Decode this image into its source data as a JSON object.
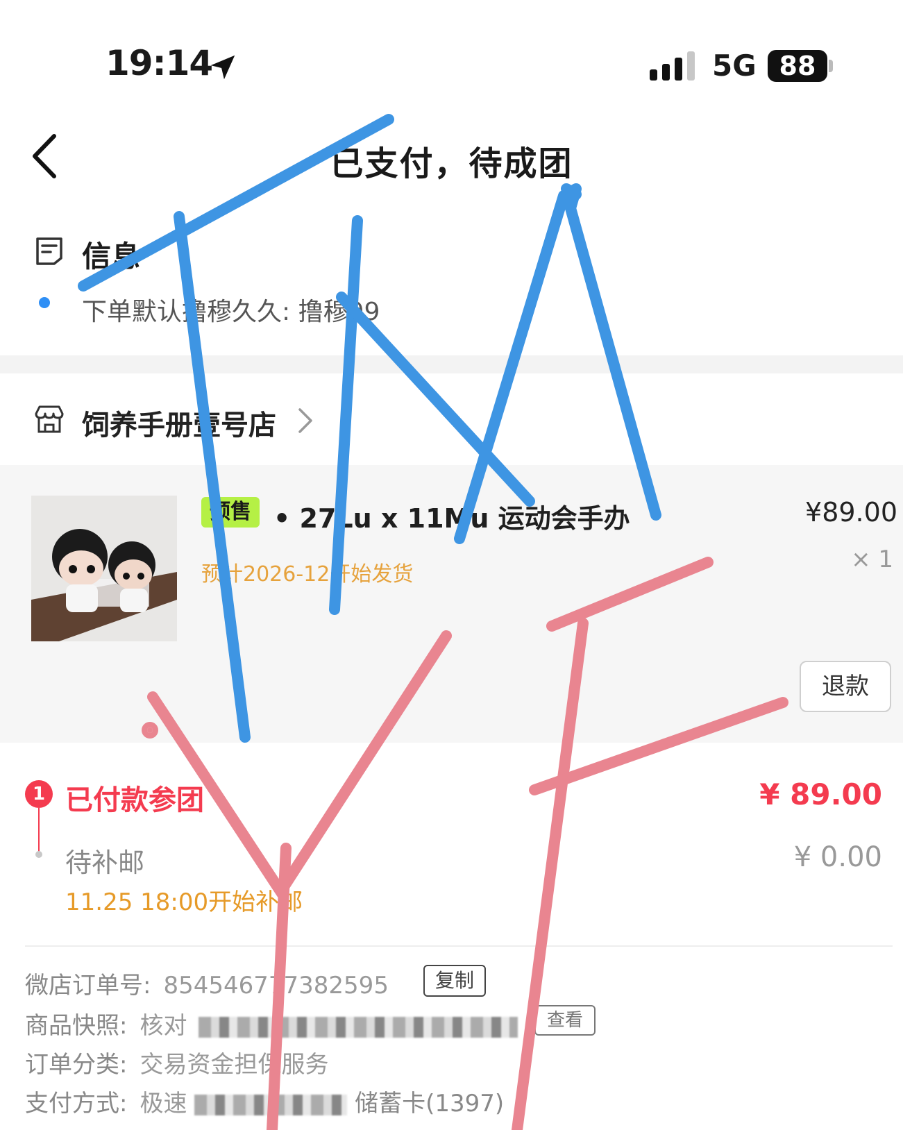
{
  "status_bar": {
    "time": "19:14",
    "network": "5G",
    "battery": "88"
  },
  "nav": {
    "title": "已支付，待成团"
  },
  "info": {
    "title": "信息",
    "line": "下单默认撸穆久久: 撸穆99"
  },
  "shop": {
    "name": "饲养手册壹号店"
  },
  "product": {
    "tag": "预售",
    "name": "• 27Lu x 11Mu 运动会手办",
    "price": "¥89.00",
    "qty": "× 1",
    "ship_note": "预计2026-12开始发货",
    "refund_label": "退款"
  },
  "steps": [
    {
      "badge": "1",
      "label": "已付款参团",
      "amount": "¥ 89.00"
    },
    {
      "label": "待补邮",
      "amount": "¥ 0.00",
      "note": "11.25 18:00开始补邮"
    }
  ],
  "order": {
    "order_no_label": "微店订单号:",
    "order_no": "854546777382595",
    "copy_label": "复制",
    "snapshot_label": "商品快照:",
    "snapshot_text": "核对",
    "view_label": "查看",
    "category_label": "订单分类:",
    "category": "交易资金担保服务",
    "payment_label": "支付方式:",
    "payment_prefix": "极速",
    "payment_suffix": "储蓄卡(1397)"
  },
  "colors": {
    "accent_red": "#f43b4f",
    "warning_orange": "#e6a23c",
    "presale_green": "#b5f045",
    "overlay_blue": "#3e95e3",
    "overlay_pink": "#e98590"
  },
  "icons": {
    "location": "location-arrow-icon",
    "signal": "signal-bars-icon",
    "back": "chevron-left-icon",
    "info": "message-doc-icon",
    "shop": "shop-awning-icon",
    "chevron": "chevron-right-icon"
  }
}
